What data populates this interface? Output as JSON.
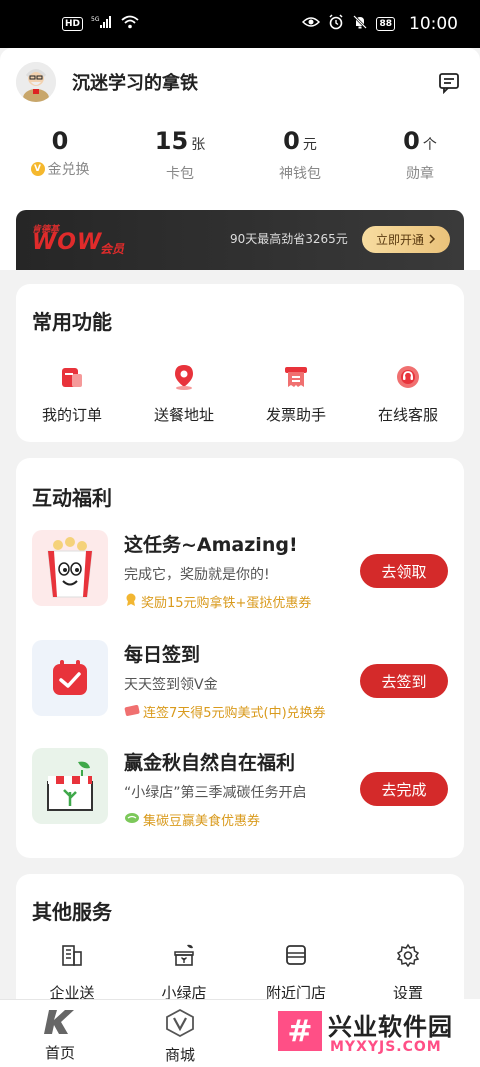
{
  "status_bar": {
    "hd": "HD",
    "signal": "5G",
    "battery": "88",
    "time": "10:00"
  },
  "profile": {
    "username": "沉迷学习的拿铁"
  },
  "stats": [
    {
      "value": "0",
      "unit": "",
      "label": "金兑换"
    },
    {
      "value": "15",
      "unit": "张",
      "label": "卡包"
    },
    {
      "value": "0",
      "unit": "元",
      "label": "神钱包"
    },
    {
      "value": "0",
      "unit": "个",
      "label": "勋章"
    }
  ],
  "wow": {
    "brand_small": "肯德基",
    "logo": "WOW",
    "member": "会员",
    "save_text": "90天最高劲省3265元",
    "button": "立即开通"
  },
  "common_functions": {
    "title": "常用功能",
    "items": [
      {
        "label": "我的订单",
        "icon": "order-icon"
      },
      {
        "label": "送餐地址",
        "icon": "location-pin-icon"
      },
      {
        "label": "发票助手",
        "icon": "invoice-icon"
      },
      {
        "label": "在线客服",
        "icon": "customer-service-icon"
      }
    ]
  },
  "interactive_benefits": {
    "title": "互动福利",
    "tasks": [
      {
        "title": "这任务~Amazing!",
        "subtitle": "完成它，奖励就是你的!",
        "reward": "奖励15元购拿铁+蛋挞优惠券",
        "button": "去领取"
      },
      {
        "title": "每日签到",
        "subtitle": "天天签到领V金",
        "reward": "连签7天得5元购美式(中)兑换券",
        "button": "去签到"
      },
      {
        "title": "赢金秋自然自在福利",
        "subtitle": "“小绿店”第三季减碳任务开启",
        "reward": "集碳豆赢美食优惠券",
        "button": "去完成"
      }
    ]
  },
  "other_services": {
    "title": "其他服务",
    "items": [
      {
        "label": "企业送",
        "icon": "building-icon"
      },
      {
        "label": "小绿店",
        "icon": "store-icon"
      },
      {
        "label": "附近门店",
        "icon": "nearby-store-icon"
      },
      {
        "label": "设置",
        "icon": "gear-icon"
      }
    ]
  },
  "bottom_nav": [
    {
      "label": "首页",
      "icon": "kfc-k-icon"
    },
    {
      "label": "商城",
      "icon": "mall-v-icon"
    }
  ],
  "watermark": {
    "cn": "兴业软件园",
    "en": "MYXYJS.COM"
  },
  "colors": {
    "accent_red": "#d42a2a",
    "reward_gold": "#d99a1c"
  }
}
